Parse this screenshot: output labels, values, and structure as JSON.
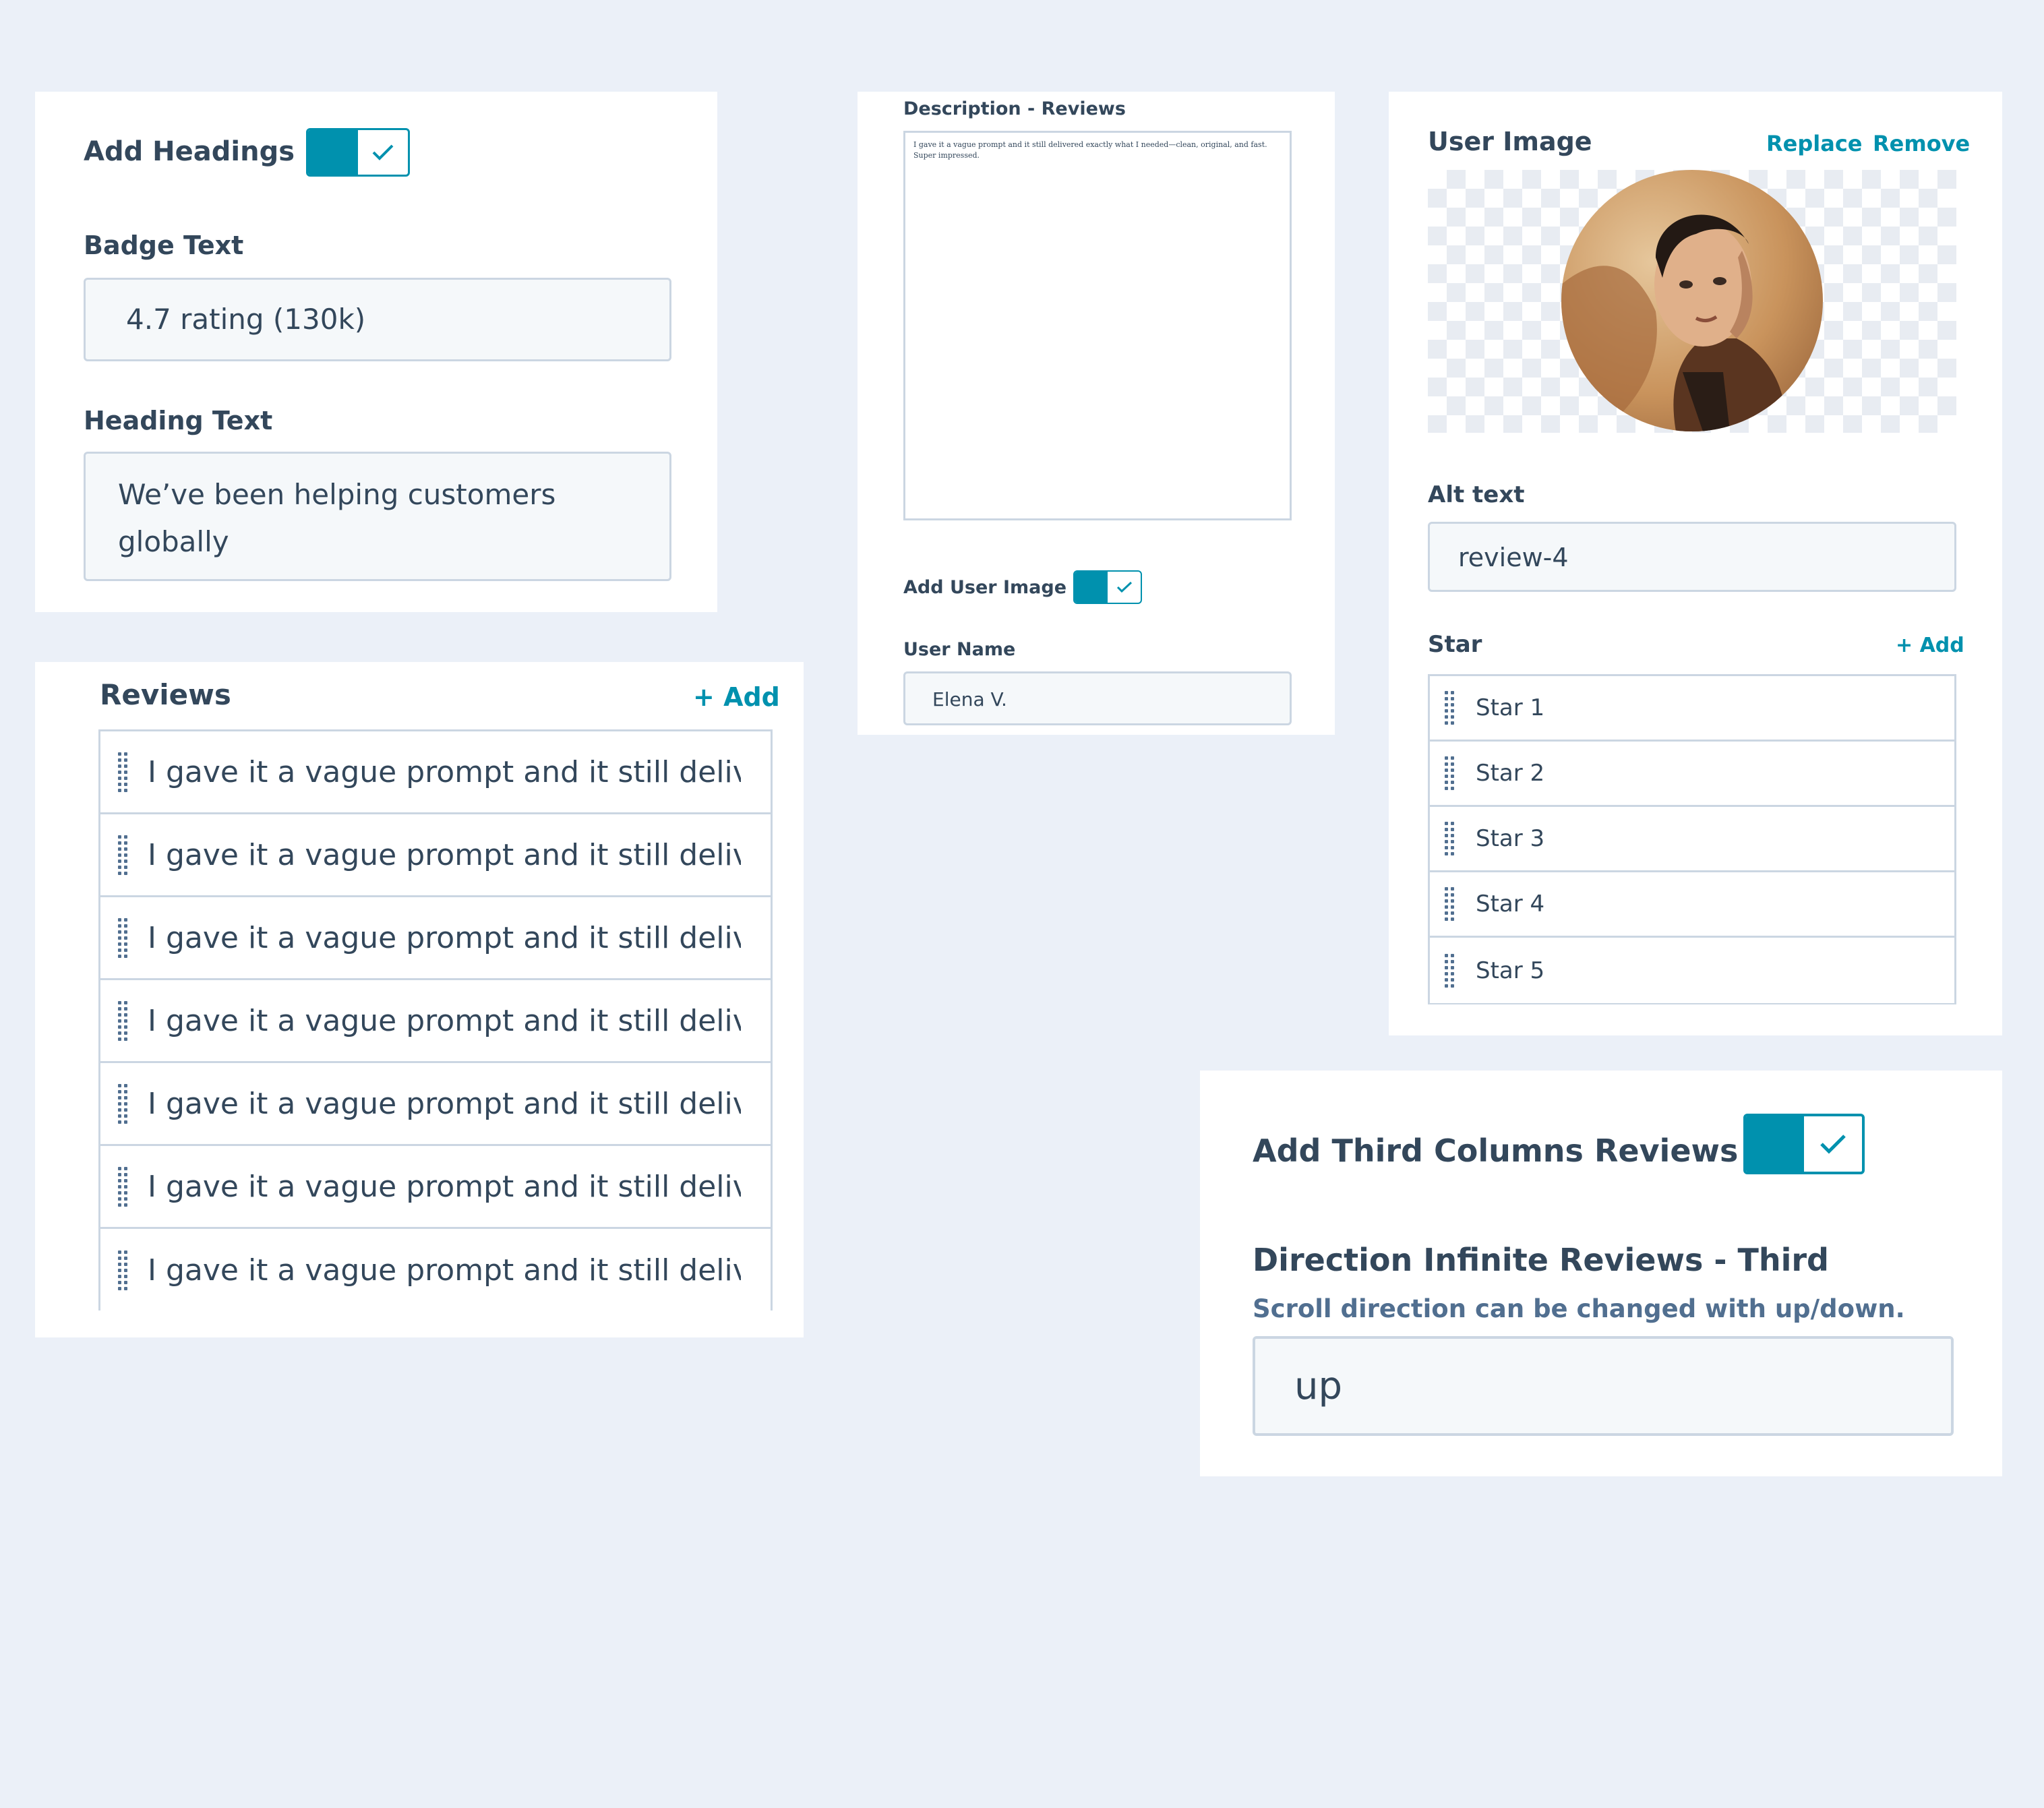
{
  "headings_panel": {
    "add_headings_label": "Add Headings",
    "add_headings_on": true,
    "badge_text_label": "Badge Text",
    "badge_text_value": "4.7 rating (130k)",
    "heading_text_label": "Heading Text",
    "heading_text_value": "We’ve been helping customers globally"
  },
  "reviews_panel": {
    "title": "Reviews",
    "add_label": "+ Add",
    "items": [
      "I gave it a vague prompt and it still delivered exactly what I needed",
      "I gave it a vague prompt and it still delivered exactly what I needed",
      "I gave it a vague prompt and it still delivered exactly what I needed",
      "I gave it a vague prompt and it still delivered exactly what I needed",
      "I gave it a vague prompt and it still delivered exactly what I needed",
      "I gave it a vague prompt and it still delivered exactly what I needed",
      "I gave it a vague prompt and it still delivered exactly what I needed"
    ]
  },
  "description_panel": {
    "description_label": "Description - Reviews",
    "description_value": "I gave it a vague prompt and it still delivered exactly what I needed—clean, original, and fast. Super impressed.",
    "add_user_image_label": "Add User Image",
    "add_user_image_on": true,
    "user_name_label": "User Name",
    "user_name_value": "Elena V."
  },
  "user_image_panel": {
    "title": "User Image",
    "replace_label": "Replace",
    "remove_label": "Remove",
    "alt_text_label": "Alt text",
    "alt_text_value": "review-4",
    "star_label": "Star",
    "star_add_label": "+ Add",
    "stars": [
      "Star 1",
      "Star 2",
      "Star 3",
      "Star 4",
      "Star 5"
    ]
  },
  "third_column_panel": {
    "add_third_label": "Add Third Columns Reviews",
    "add_third_on": true,
    "direction_label": "Direction Infinite Reviews - Third",
    "direction_help": "Scroll direction can be changed with up/down.",
    "direction_value": "up"
  },
  "colors": {
    "accent": "#0091ae",
    "background": "#ebf0f8",
    "border": "#cbd6e2",
    "text": "#33475b"
  }
}
